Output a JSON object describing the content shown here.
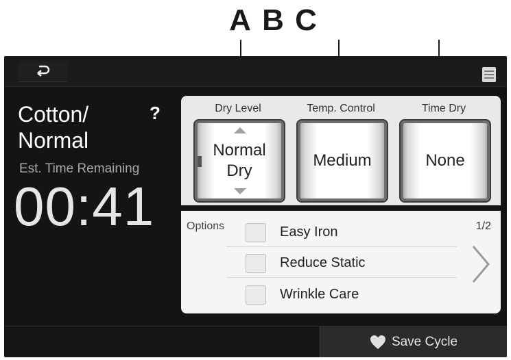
{
  "callouts": [
    "A",
    "B",
    "C"
  ],
  "icons": {
    "back": "back-arrow-icon",
    "menu": "menu-icon",
    "help": "help-icon",
    "heart": "heart-icon",
    "next": "chevron-right-icon"
  },
  "cycle": {
    "name_line1": "Cotton/",
    "name_line2": "Normal",
    "help_label": "?",
    "est_label": "Est. Time Remaining",
    "time_remaining": "00:41"
  },
  "settings": [
    {
      "title": "Dry Level",
      "value_line1": "Normal",
      "value_line2": "Dry"
    },
    {
      "title": "Temp. Control",
      "value_line1": "Medium",
      "value_line2": ""
    },
    {
      "title": "Time Dry",
      "value_line1": "None",
      "value_line2": ""
    }
  ],
  "options": {
    "label": "Options",
    "page": "1/2",
    "items": [
      {
        "label": "Easy Iron",
        "checked": false
      },
      {
        "label": "Reduce Static",
        "checked": false
      },
      {
        "label": "Wrinkle Care",
        "checked": false
      }
    ]
  },
  "footer": {
    "save_label": "Save Cycle"
  },
  "colors": {
    "screen_bg": "#141414",
    "panel_bg": "#e9e9e9",
    "text_light": "#ffffff"
  }
}
